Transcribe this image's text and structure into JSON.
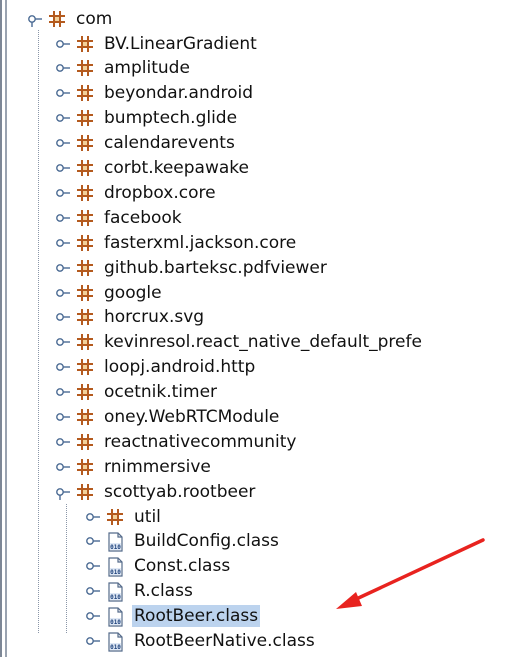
{
  "tree": {
    "root": {
      "label": "com",
      "icon": "package-icon",
      "expanded": true
    },
    "packages": [
      {
        "label": "BV.LinearGradient",
        "icon": "package-icon"
      },
      {
        "label": "amplitude",
        "icon": "package-icon"
      },
      {
        "label": "beyondar.android",
        "icon": "package-icon"
      },
      {
        "label": "bumptech.glide",
        "icon": "package-icon"
      },
      {
        "label": "calendarevents",
        "icon": "package-icon"
      },
      {
        "label": "corbt.keepawake",
        "icon": "package-icon"
      },
      {
        "label": "dropbox.core",
        "icon": "package-icon"
      },
      {
        "label": "facebook",
        "icon": "package-icon"
      },
      {
        "label": "fasterxml.jackson.core",
        "icon": "package-icon"
      },
      {
        "label": "github.barteksc.pdfviewer",
        "icon": "package-icon"
      },
      {
        "label": "google",
        "icon": "package-icon"
      },
      {
        "label": "horcrux.svg",
        "icon": "package-icon"
      },
      {
        "label": "kevinresol.react_native_default_prefe",
        "icon": "package-icon"
      },
      {
        "label": "loopj.android.http",
        "icon": "package-icon"
      },
      {
        "label": "ocetnik.timer",
        "icon": "package-icon"
      },
      {
        "label": "oney.WebRTCModule",
        "icon": "package-icon"
      },
      {
        "label": "reactnativecommunity",
        "icon": "package-icon"
      },
      {
        "label": "rnimmersive",
        "icon": "package-icon"
      },
      {
        "label": "scottyab.rootbeer",
        "icon": "package-icon",
        "expanded": true
      }
    ],
    "rootbeer_children": [
      {
        "label": "util",
        "icon": "package-icon"
      },
      {
        "label": "BuildConfig.class",
        "icon": "class-file-icon"
      },
      {
        "label": "Const.class",
        "icon": "class-file-icon"
      },
      {
        "label": "R.class",
        "icon": "class-file-icon"
      },
      {
        "label": "RootBeer.class",
        "icon": "class-file-icon",
        "selected": true
      },
      {
        "label": "RootBeerNative.class",
        "icon": "class-file-icon"
      }
    ]
  },
  "colors": {
    "selection": "#bcd3ee",
    "package_icon": "#b45a1e",
    "arrow": "#e8231f",
    "tree_line": "#8a96a8"
  }
}
